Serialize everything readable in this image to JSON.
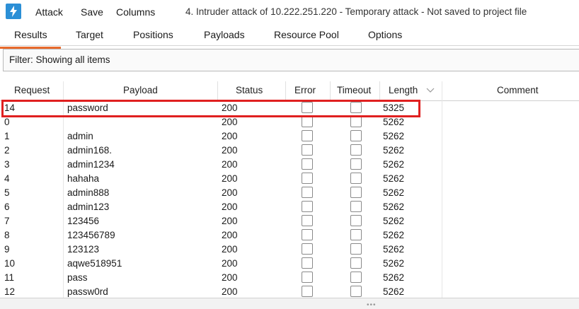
{
  "menubar": {
    "app_icon": "lightning-icon",
    "items": [
      "Attack",
      "Save",
      "Columns"
    ],
    "title": "4. Intruder attack of 10.222.251.220 - Temporary attack - Not saved to project file"
  },
  "tabs": [
    "Results",
    "Target",
    "Positions",
    "Payloads",
    "Resource Pool",
    "Options"
  ],
  "active_tab": "Results",
  "accent_color": "#e86a2c",
  "filter": {
    "label": "Filter: Showing all items"
  },
  "table": {
    "columns": [
      "Request",
      "Payload",
      "Status",
      "Error",
      "Timeout",
      "Length",
      "Comment"
    ],
    "sort_icon": "chevron-down-icon",
    "rows": [
      {
        "request": "14",
        "payload": "password",
        "status": "200",
        "length": "5325"
      },
      {
        "request": "0",
        "payload": "",
        "status": "200",
        "length": "5262"
      },
      {
        "request": "1",
        "payload": "admin",
        "status": "200",
        "length": "5262"
      },
      {
        "request": "2",
        "payload": "admin168.",
        "status": "200",
        "length": "5262"
      },
      {
        "request": "3",
        "payload": "admin1234",
        "status": "200",
        "length": "5262"
      },
      {
        "request": "4",
        "payload": "hahaha",
        "status": "200",
        "length": "5262"
      },
      {
        "request": "5",
        "payload": "admin888",
        "status": "200",
        "length": "5262"
      },
      {
        "request": "6",
        "payload": "admin123",
        "status": "200",
        "length": "5262"
      },
      {
        "request": "7",
        "payload": "123456",
        "status": "200",
        "length": "5262"
      },
      {
        "request": "8",
        "payload": "123456789",
        "status": "200",
        "length": "5262"
      },
      {
        "request": "9",
        "payload": "123123",
        "status": "200",
        "length": "5262"
      },
      {
        "request": "10",
        "payload": "aqwe518951",
        "status": "200",
        "length": "5262"
      },
      {
        "request": "11",
        "payload": "pass",
        "status": "200",
        "length": "5262"
      },
      {
        "request": "12",
        "payload": "passw0rd",
        "status": "200",
        "length": "5262"
      }
    ]
  },
  "highlight_color": "#e02020"
}
